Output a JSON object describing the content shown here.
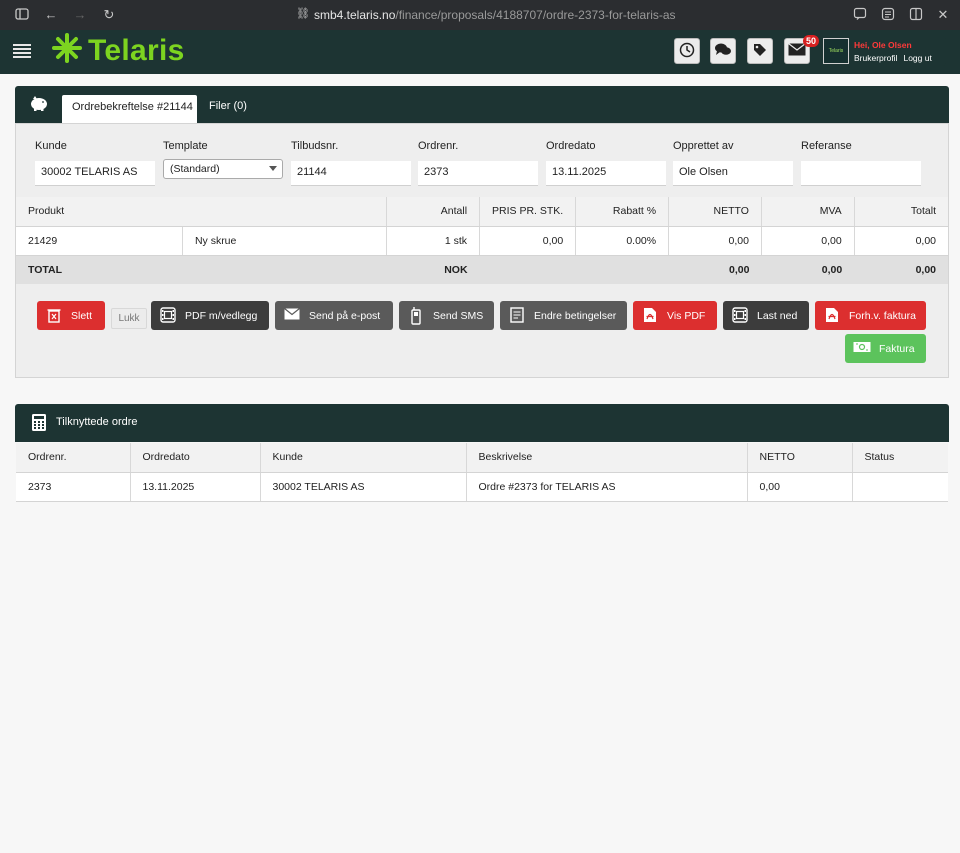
{
  "browser": {
    "url_host": "smb4.telaris.no",
    "url_path": "/finance/proposals/4188707/ordre-2373-for-telaris-as"
  },
  "header": {
    "logo": "Telaris",
    "notification_count": "50",
    "avatar_text": "Telaris",
    "greeting": "Hei, Ole Olsen",
    "profile_link": "Brukerprofil",
    "logout_link": "Logg ut"
  },
  "tabs": [
    {
      "label": "Ordrebekreftelse #21144"
    },
    {
      "label": "Filer (0)"
    }
  ],
  "fields": [
    {
      "label": "Kunde",
      "value": "30002 TELARIS AS"
    },
    {
      "label": "Template",
      "value": "(Standard)"
    },
    {
      "label": "Tilbudsnr.",
      "value": "21144"
    },
    {
      "label": "Ordrenr.",
      "value": "2373"
    },
    {
      "label": "Ordredato",
      "value": "13.11.2025"
    },
    {
      "label": "Opprettet av",
      "value": "Ole Olsen"
    },
    {
      "label": "Referanse",
      "value": ""
    }
  ],
  "lines": {
    "headers": [
      "Produkt",
      "Antall",
      "PRIS PR. STK.",
      "Rabatt %",
      "NETTO",
      "MVA",
      "Totalt"
    ],
    "rows": [
      {
        "product": "21429",
        "description": "Ny skrue",
        "qty": "1 stk",
        "price": "0,00",
        "discount": "0.00%",
        "net": "0,00",
        "vat": "0,00",
        "total": "0,00"
      }
    ],
    "total": {
      "label": "TOTAL",
      "currency": "NOK",
      "net": "0,00",
      "vat": "0,00",
      "total": "0,00"
    }
  },
  "actions": {
    "delete": "Slett",
    "close": "Lukk",
    "pdf_attach": "PDF m/vedlegg",
    "send_email": "Send på e-post",
    "send_sms": "Send SMS",
    "change_terms": "Endre betingelser",
    "view_pdf": "Vis PDF",
    "download": "Last ned",
    "prepay_invoice": "Forh.v. faktura",
    "invoice": "Faktura"
  },
  "related": {
    "title": "Tilknyttede ordre",
    "headers": [
      "Ordrenr.",
      "Ordredato",
      "Kunde",
      "Beskrivelse",
      "NETTO",
      "Status"
    ],
    "rows": [
      {
        "order": "2373",
        "date": "13.11.2025",
        "customer": "30002 TELARIS AS",
        "description": "Ordre #2373 for TELARIS AS",
        "net": "0,00",
        "status": ""
      }
    ]
  },
  "colors": {
    "header_bg": "#1d3433",
    "brand_green": "#7dd420",
    "danger": "#dc2f2f",
    "success": "#5cc35c"
  }
}
